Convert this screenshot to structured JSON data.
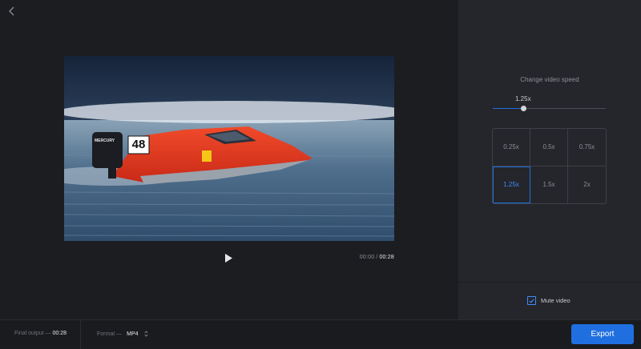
{
  "header": {
    "back_icon": "chevron-left-icon"
  },
  "player": {
    "current_time": "00:00",
    "separator": "/",
    "total_time": "00:28",
    "play_icon": "play-icon",
    "race_number": "48",
    "engine_brand": "MERCURY"
  },
  "speed": {
    "heading": "Change video speed",
    "current": "1.25x",
    "slider_fraction": 0.27,
    "options": [
      "0.25x",
      "0.5x",
      "0.75x",
      "1.25x",
      "1.5x",
      "2x"
    ],
    "selected_index": 3
  },
  "mute": {
    "label": "Mute video",
    "checked": true
  },
  "footer": {
    "final_output_label": "Final output —",
    "final_output_value": "00:28",
    "format_label": "Format —",
    "format_value": "MP4",
    "export_label": "Export"
  },
  "colors": {
    "accent": "#1f6fe0",
    "boat_red": "#e8361f",
    "background": "#1c1d21",
    "panel": "#25262b"
  }
}
